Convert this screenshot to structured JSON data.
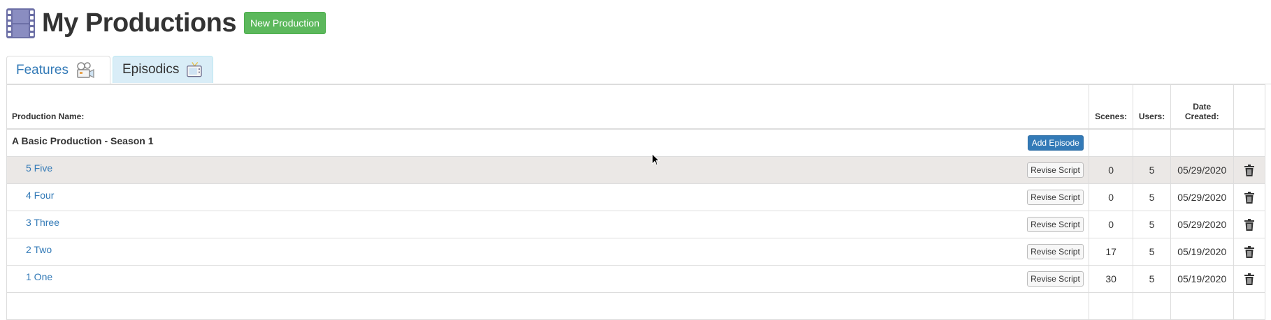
{
  "page": {
    "title": "My Productions",
    "new_button_label": "New Production"
  },
  "tabs": [
    {
      "label": "Features",
      "icon": "camera-icon",
      "active": false
    },
    {
      "label": "Episodics",
      "icon": "tv-icon",
      "active": true
    }
  ],
  "table": {
    "headers": {
      "name": "Production Name:",
      "scenes": "Scenes:",
      "users": "Users:",
      "date_line1": "Date",
      "date_line2": "Created:"
    },
    "season": {
      "name": "A Basic Production - Season 1",
      "add_episode_label": "Add Episode"
    },
    "revise_label": "Revise Script",
    "episodes": [
      {
        "name": "5 Five",
        "scenes": "0",
        "users": "5",
        "date": "05/29/2020"
      },
      {
        "name": "4 Four",
        "scenes": "0",
        "users": "5",
        "date": "05/29/2020"
      },
      {
        "name": "3 Three",
        "scenes": "0",
        "users": "5",
        "date": "05/29/2020"
      },
      {
        "name": "2 Two",
        "scenes": "17",
        "users": "5",
        "date": "05/19/2020"
      },
      {
        "name": "1 One",
        "scenes": "30",
        "users": "5",
        "date": "05/19/2020"
      }
    ]
  },
  "colors": {
    "success_button": "#5cb85c",
    "primary_button": "#337ab7",
    "link": "#337ab7",
    "active_tab_bg": "#d9edf7",
    "hover_row_bg": "#ebe8e6"
  },
  "icons": {
    "title_icon": "film-strip-icon",
    "delete_icon": "trash-icon"
  }
}
